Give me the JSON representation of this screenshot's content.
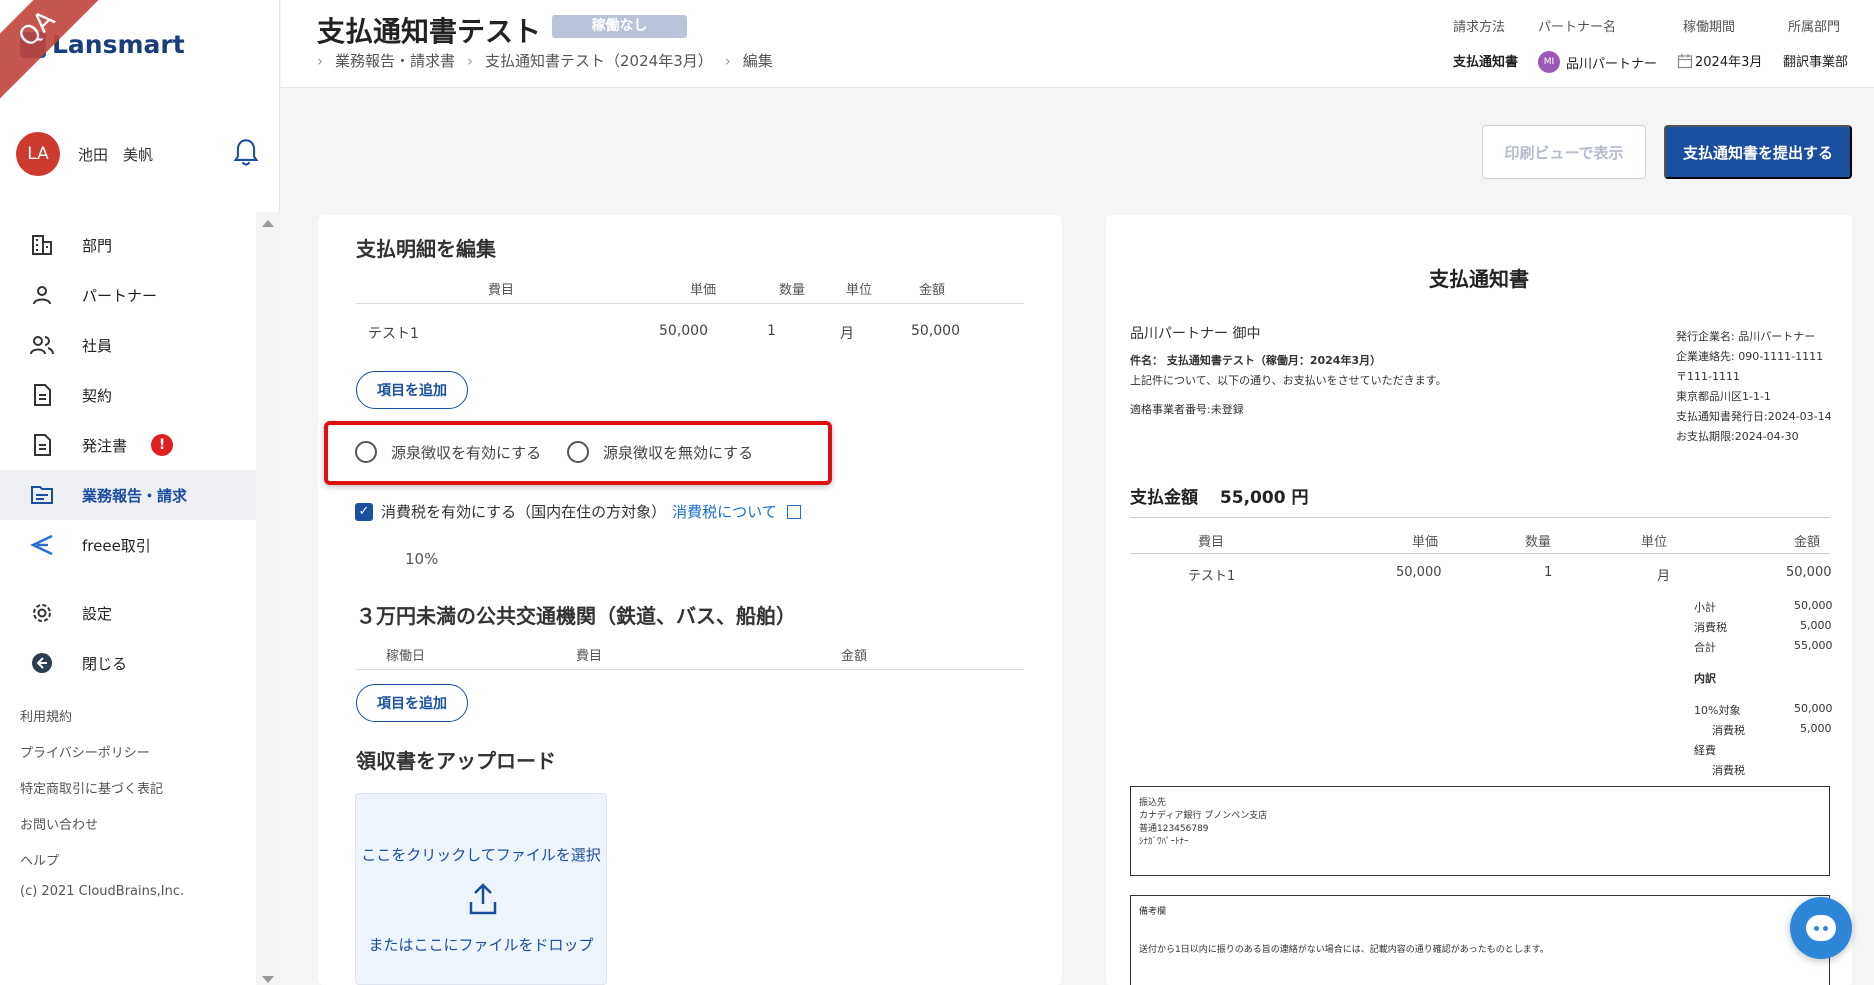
{
  "app": {
    "logo_text": "Lansmart",
    "env_ribbon": "QA"
  },
  "user": {
    "initials": "LA",
    "name": "池田　美帆"
  },
  "sidebar": {
    "items": [
      {
        "label": "部門",
        "icon": "building-icon"
      },
      {
        "label": "パートナー",
        "icon": "person-icon"
      },
      {
        "label": "社員",
        "icon": "people-icon"
      },
      {
        "label": "契約",
        "icon": "document-icon"
      },
      {
        "label": "発注書",
        "icon": "document-icon",
        "badge": "!"
      },
      {
        "label": "業務報告・請求",
        "icon": "report-icon",
        "active": true
      },
      {
        "label": "freee取引",
        "icon": "freee-icon"
      }
    ],
    "secondary": [
      {
        "label": "設定",
        "icon": "gear-icon"
      },
      {
        "label": "閉じる",
        "icon": "close-arrow-icon"
      }
    ],
    "footer_links": [
      "利用規約",
      "プライバシーポリシー",
      "特定商取引に基づく表記",
      "お問い合わせ",
      "ヘルプ"
    ],
    "copyright": "(c) 2021 CloudBrains,Inc."
  },
  "header": {
    "title": "支払通知書テスト",
    "status": "稼働なし",
    "breadcrumb": [
      "業務報告・請求書",
      "支払通知書テスト（2024年3月）",
      "編集"
    ],
    "meta": [
      {
        "label": "請求方法",
        "value": "支払通知書"
      },
      {
        "label": "パートナー名",
        "value": "品川パートナー",
        "avatar": "MI"
      },
      {
        "label": "稼働期間",
        "value": "2024年3月"
      },
      {
        "label": "所属部門",
        "value": "翻訳事業部"
      }
    ]
  },
  "actions": {
    "print_view": "印刷ビューで表示",
    "submit": "支払通知書を提出する"
  },
  "edit": {
    "section_title": "支払明細を編集",
    "columns": [
      "費目",
      "単価",
      "数量",
      "単位",
      "金額"
    ],
    "rows": [
      {
        "item": "テスト1",
        "price": "50,000",
        "qty": "1",
        "unit": "月",
        "amount": "50,000"
      }
    ],
    "add_item": "項目を追加",
    "withholding_on": "源泉徴収を有効にする",
    "withholding_off": "源泉徴収を無効にする",
    "tax_checkbox": "消費税を有効にする（国内在住の方対象）",
    "tax_checked": true,
    "tax_link": "消費税について",
    "tax_rate": "10%",
    "transport_title": "３万円未満の公共交通機関（鉄道、バス、船舶）",
    "transport_columns": [
      "稼働日",
      "費目",
      "金額"
    ],
    "transport_add": "項目を追加",
    "upload_title": "領収書をアップロード",
    "upload_click": "ここをクリックしてファイルを選択",
    "upload_drop": "またはここにファイルをドロップ"
  },
  "preview": {
    "title": "支払通知書",
    "recipient": "品川パートナー 御中",
    "subject": "件名： 支払通知書テスト（稼働月：2024年3月）",
    "intro": "上記件について、以下の通り、お支払いをさせていただきます。",
    "registration": "適格事業者番号:未登録",
    "issuer": [
      "発行企業名: 品川パートナー",
      "企業連絡先: 090-1111-1111",
      "〒111-1111",
      "東京都品川区1-1-1",
      "支払通知書発行日:2024-03-14",
      "お支払期限:2024-04-30"
    ],
    "amount_label": "支払金額",
    "amount_value": "55,000 円",
    "columns": [
      "費目",
      "単価",
      "数量",
      "単位",
      "金額"
    ],
    "rows": [
      {
        "item": "テスト1",
        "price": "50,000",
        "qty": "1",
        "unit": "月",
        "amount": "50,000"
      }
    ],
    "summary": [
      {
        "label": "小計",
        "value": "50,000"
      },
      {
        "label": "消費税",
        "value": "5,000"
      },
      {
        "label": "合計",
        "value": "55,000"
      }
    ],
    "breakdown_label": "内訳",
    "breakdown": [
      {
        "label": "10%対象",
        "value": "50,000"
      },
      {
        "label": "消費税",
        "value": "5,000"
      },
      {
        "label": "経費",
        "value": ""
      },
      {
        "label": "消費税",
        "value": ""
      }
    ],
    "bank": [
      "振込先",
      "カナディア銀行 プノンペン支店",
      "普通123456789",
      "ｼﾅｶﾞﾜﾊﾟｰﾄﾅｰ"
    ],
    "remarks_label": "備考欄",
    "remarks": "送付から1日以内に振りのある旨の連絡がない場合には、記載内容の通り確認があったものとします。"
  }
}
